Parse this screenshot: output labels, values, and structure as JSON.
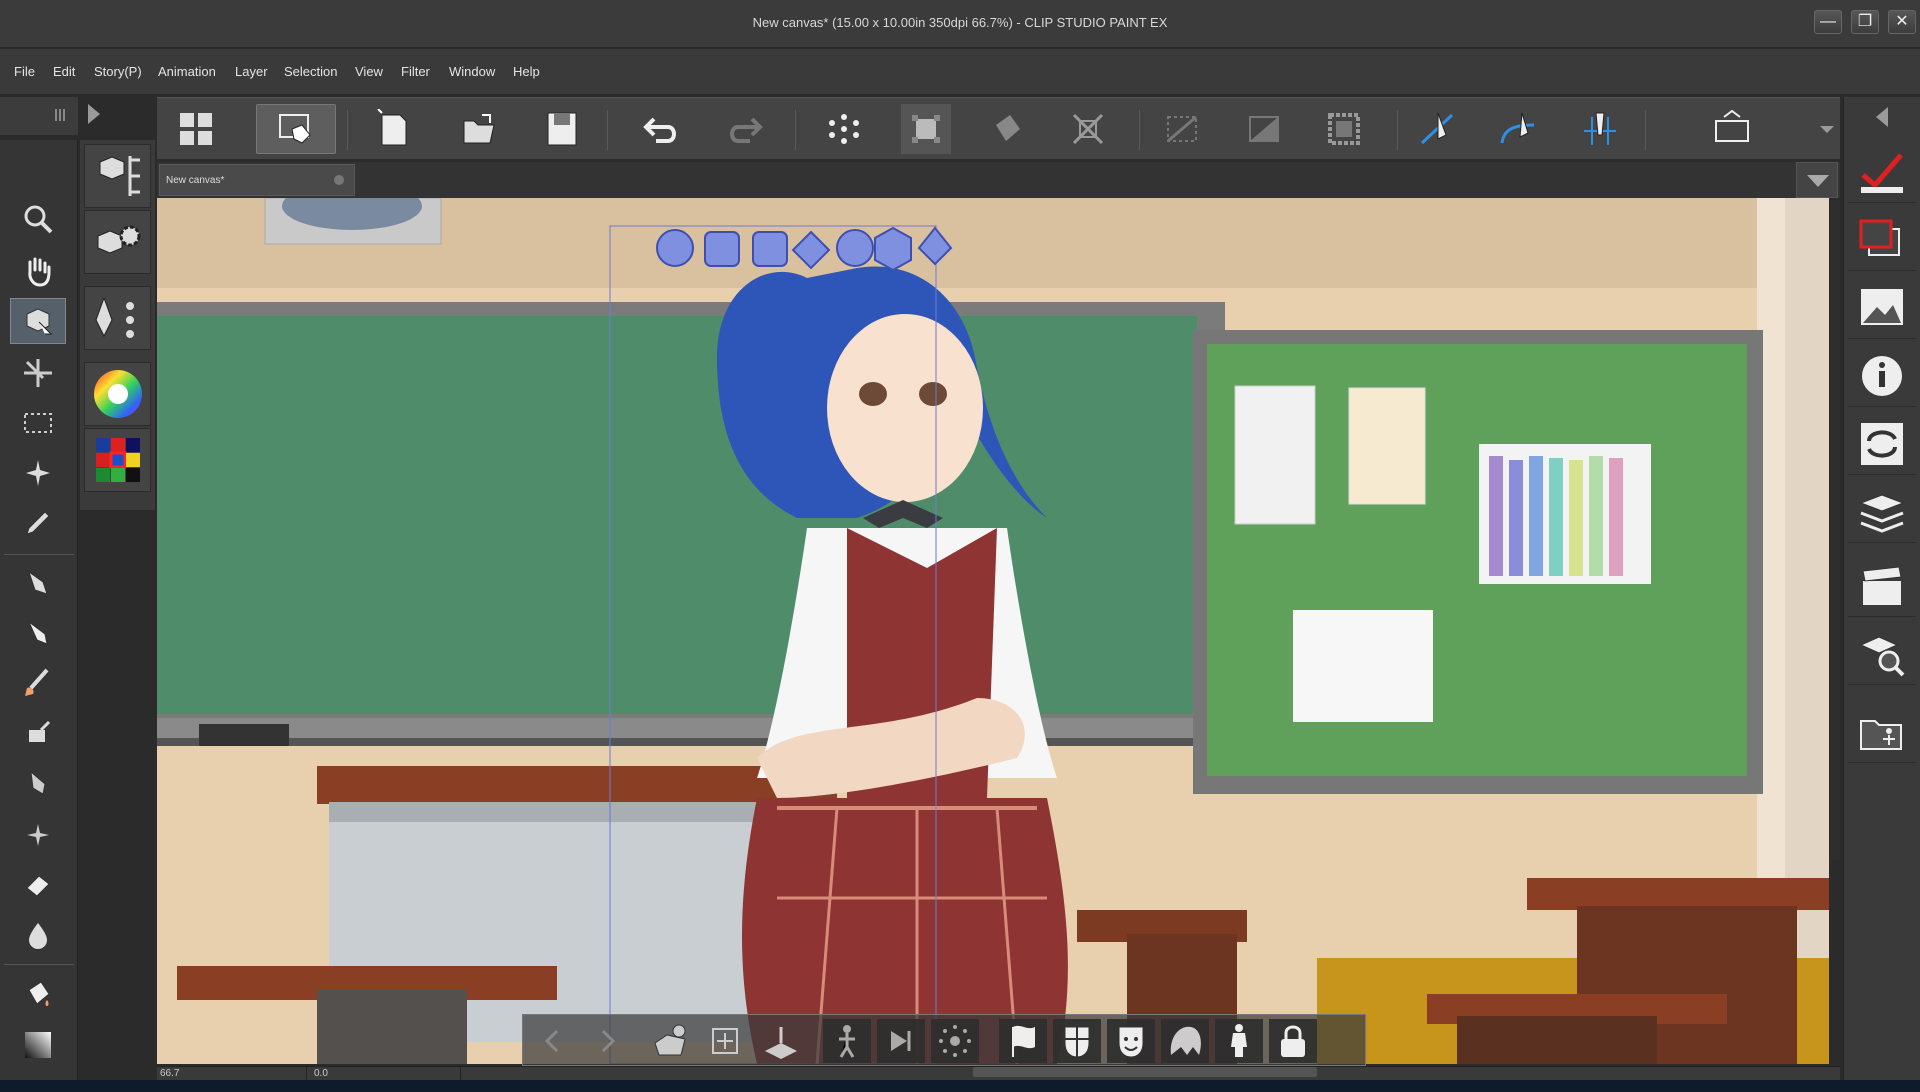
{
  "window": {
    "title": "New canvas* (15.00 x 10.00in 350dpi 66.7%)  - CLIP STUDIO PAINT EX",
    "minimize": "—",
    "maximize": "❐",
    "close": "✕"
  },
  "menu": {
    "items": [
      "File",
      "Edit",
      "Story(P)",
      "Animation",
      "Layer",
      "Selection",
      "View",
      "Filter",
      "Window",
      "Help"
    ]
  },
  "tab": {
    "label": "New canvas*"
  },
  "status": {
    "zoom": "66.7",
    "angle": "0.0"
  },
  "colors": {
    "accent_blue": "#2f8fe6",
    "selection_outline": "#6c7bd6",
    "chalkboard": "#4e8f6a",
    "bulletin_board": "#5fa05b"
  }
}
